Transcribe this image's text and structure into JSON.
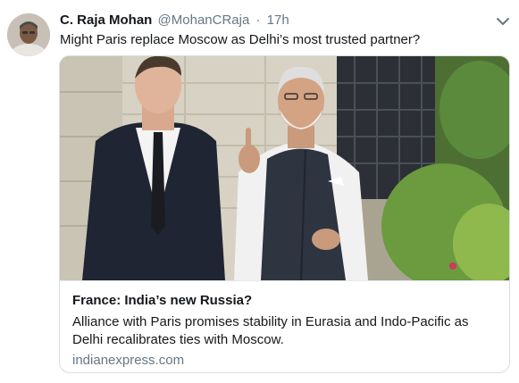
{
  "author": {
    "name": "C. Raja Mohan",
    "handle": "@MohanCRaja",
    "separator": "·",
    "time": "17h"
  },
  "tweet": {
    "text": "Might Paris replace Moscow as Delhi’s most trusted partner?"
  },
  "card": {
    "title": "France: India’s new Russia?",
    "description": "Alliance with Paris promises stability in Eurasia and Indo-Pacific as Delhi recalibrates ties with Moscow.",
    "domain": "indianexpress.com"
  },
  "icons": {
    "menu": "chevron-down-icon"
  },
  "colors": {
    "text": "#14171a",
    "secondary_text": "#657786",
    "card_border": "#d8dee3"
  }
}
